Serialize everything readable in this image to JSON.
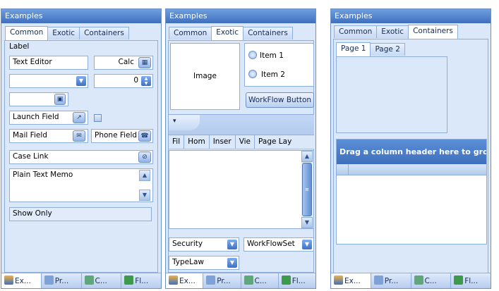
{
  "panels": [
    {
      "title": "Examples",
      "tabs": [
        "Common",
        "Exotic",
        "Containers"
      ],
      "active_tab": 0
    },
    {
      "title": "Examples",
      "tabs": [
        "Common",
        "Exotic",
        "Containers"
      ],
      "active_tab": 1
    },
    {
      "title": "Examples",
      "tabs": [
        "Common",
        "Exotic",
        "Containers"
      ],
      "active_tab": 2
    }
  ],
  "common": {
    "label": "Label",
    "text_editor": "Text Editor",
    "calc": "Calc",
    "dropdown_value": "",
    "spin_value": "0",
    "date_value": "",
    "launch_field": "Launch Field",
    "mail_field": "Mail Field",
    "phone_field": "Phone Field",
    "case_link": "Case Link",
    "memo": "Plain Text Memo",
    "show_only": "Show Only"
  },
  "exotic": {
    "image_label": "Image",
    "radio_items": [
      "Item 1",
      "Item 2"
    ],
    "workflow_button": "WorkFlow Button",
    "ribbon_tabs": [
      "Fil",
      "Hom",
      "Inser",
      "Vie",
      "Page Lay"
    ],
    "ribbon_menu_glyph": "▾",
    "security": "Security",
    "workflowset": "WorkFlowSet",
    "typelaw": "TypeLaw"
  },
  "containers": {
    "page_tabs": [
      "Page 1",
      "Page 2"
    ],
    "group_hint": "Drag a column header here to group"
  },
  "bottom_tabs": [
    "Ex...",
    "Pr...",
    "C...",
    "Fl..."
  ],
  "icons": {
    "calc": "calculator-icon",
    "calendar": "calendar-icon",
    "launch": "launch-icon",
    "mail": "mail-icon",
    "phone": "phone-icon",
    "link": "link-icon"
  }
}
